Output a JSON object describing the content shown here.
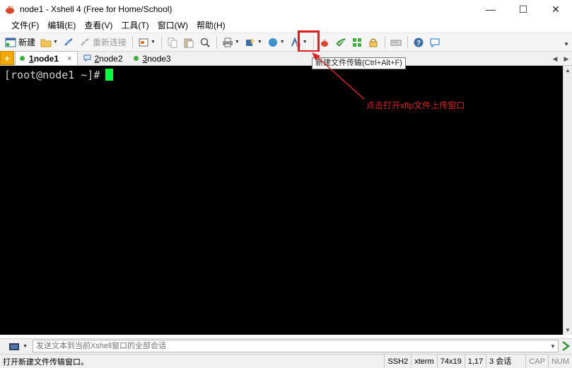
{
  "window": {
    "title": "node1 - Xshell 4 (Free for Home/School)",
    "minimize_glyph": "—",
    "maximize_glyph": "☐",
    "close_glyph": "✕"
  },
  "menu": [
    {
      "label": "文件(F)"
    },
    {
      "label": "编辑(E)"
    },
    {
      "label": "查看(V)"
    },
    {
      "label": "工具(T)"
    },
    {
      "label": "窗口(W)"
    },
    {
      "label": "帮助(H)"
    }
  ],
  "toolbar": {
    "new_label": "新建",
    "reconnect_label": "重新连接",
    "new_file_transfer_tooltip": "新建文件传输(Ctrl+Alt+F)"
  },
  "tabs": [
    {
      "num": "1",
      "label": " node1",
      "active": true,
      "close": "×"
    },
    {
      "num": "2",
      "label": " node2"
    },
    {
      "num": "3",
      "label": " node3"
    }
  ],
  "tab_add_glyph": "+",
  "tab_nav": {
    "left": "◀",
    "right": "▶"
  },
  "terminal": {
    "prompt": "[root@node1 ~]#"
  },
  "annotation": {
    "text": "点击打开xftp文件上传窗口",
    "color": "#e02020"
  },
  "compose": {
    "placeholder": "发送文本到当前Xshell窗口的全部会话"
  },
  "status": {
    "message": "打开新建文件传输窗口。",
    "protocol": "SSH2",
    "terminal_type": "xterm",
    "size": "74x19",
    "cursor_pos": "1,17",
    "sessions": "3 会话",
    "cap": "CAP",
    "num": "NUM"
  },
  "colors": {
    "terminal_bg": "#000000",
    "cursor": "#00ff3c",
    "tab_add": "#f2a800",
    "highlight": "#e02020"
  }
}
